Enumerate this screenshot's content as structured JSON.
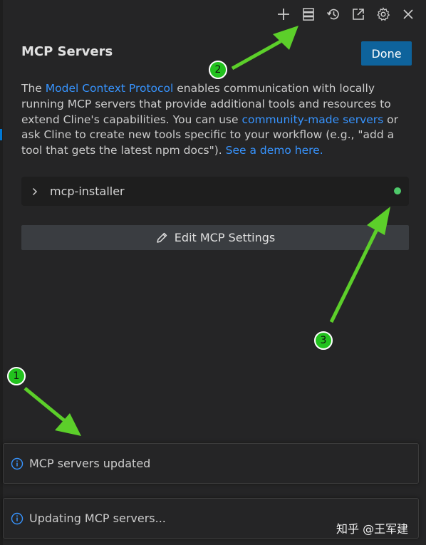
{
  "toolbar": {
    "icons": [
      "plus-icon",
      "server-icon",
      "history-icon",
      "popout-icon",
      "gear-icon",
      "close-icon"
    ]
  },
  "panel": {
    "title": "MCP Servers",
    "done_label": "Done"
  },
  "description": {
    "t1": "The ",
    "link1": "Model Context Protocol",
    "t2": " enables communication with locally running MCP servers that provide additional tools and resources to extend Cline's capabilities. You can use ",
    "link2": "community-made servers",
    "t3": " or ask Cline to create new tools specific to your workflow (e.g., \"add a tool that gets the latest npm docs\"). ",
    "link3": "See a demo here."
  },
  "servers": [
    {
      "name": "mcp-installer",
      "status_color": "#4ec96a"
    }
  ],
  "edit_settings_label": "Edit MCP Settings",
  "notifications": [
    {
      "message": "MCP servers updated"
    },
    {
      "message": "Updating MCP servers..."
    }
  ],
  "callouts": [
    "1",
    "2",
    "3"
  ],
  "watermark": "知乎 @王军建",
  "colors": {
    "background": "#252526",
    "accent": "#0e639c",
    "link": "#3794ff",
    "status_dot": "#4ec96a",
    "annotation": "#22c21e"
  }
}
